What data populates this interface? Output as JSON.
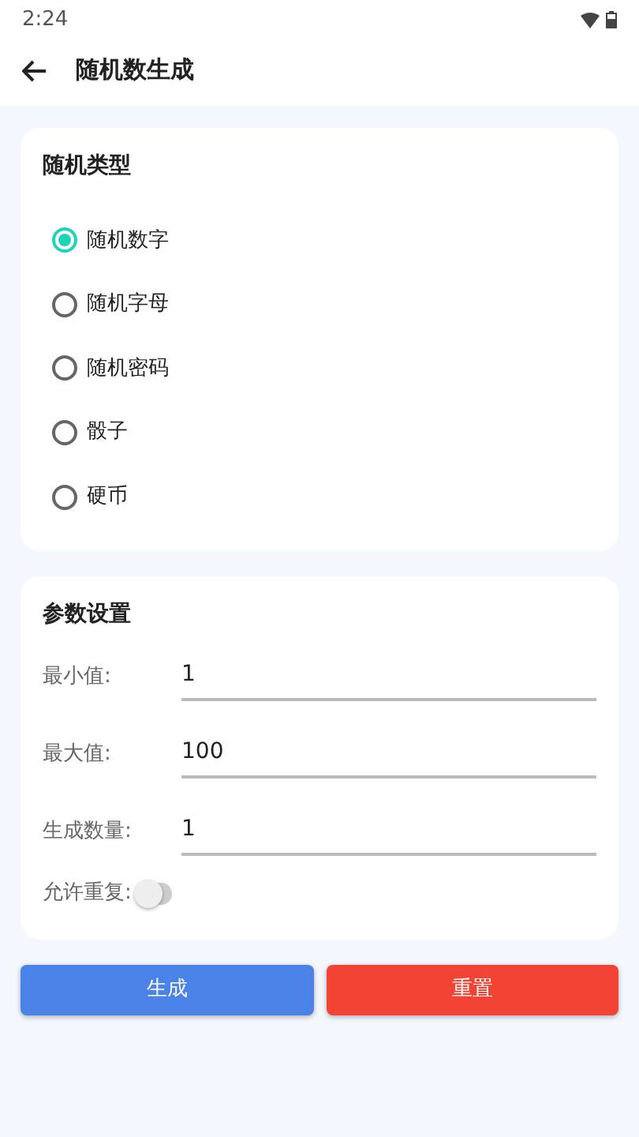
{
  "status_bar": {
    "time": "2:24"
  },
  "app_bar": {
    "title": "随机数生成"
  },
  "type_card": {
    "title": "随机类型",
    "options": [
      {
        "label": "随机数字",
        "selected": true
      },
      {
        "label": "随机字母",
        "selected": false
      },
      {
        "label": "随机密码",
        "selected": false
      },
      {
        "label": "骰子",
        "selected": false
      },
      {
        "label": "硬币",
        "selected": false
      }
    ]
  },
  "params_card": {
    "title": "参数设置",
    "fields": [
      {
        "label": "最小值:",
        "value": "1"
      },
      {
        "label": "最大值:",
        "value": "100"
      },
      {
        "label": "生成数量:",
        "value": "1"
      }
    ],
    "allow_repeat": {
      "label": "允许重复:",
      "on": false
    }
  },
  "buttons": [
    {
      "label": "生成",
      "kind": "primary"
    },
    {
      "label": "重置",
      "kind": "danger"
    }
  ]
}
